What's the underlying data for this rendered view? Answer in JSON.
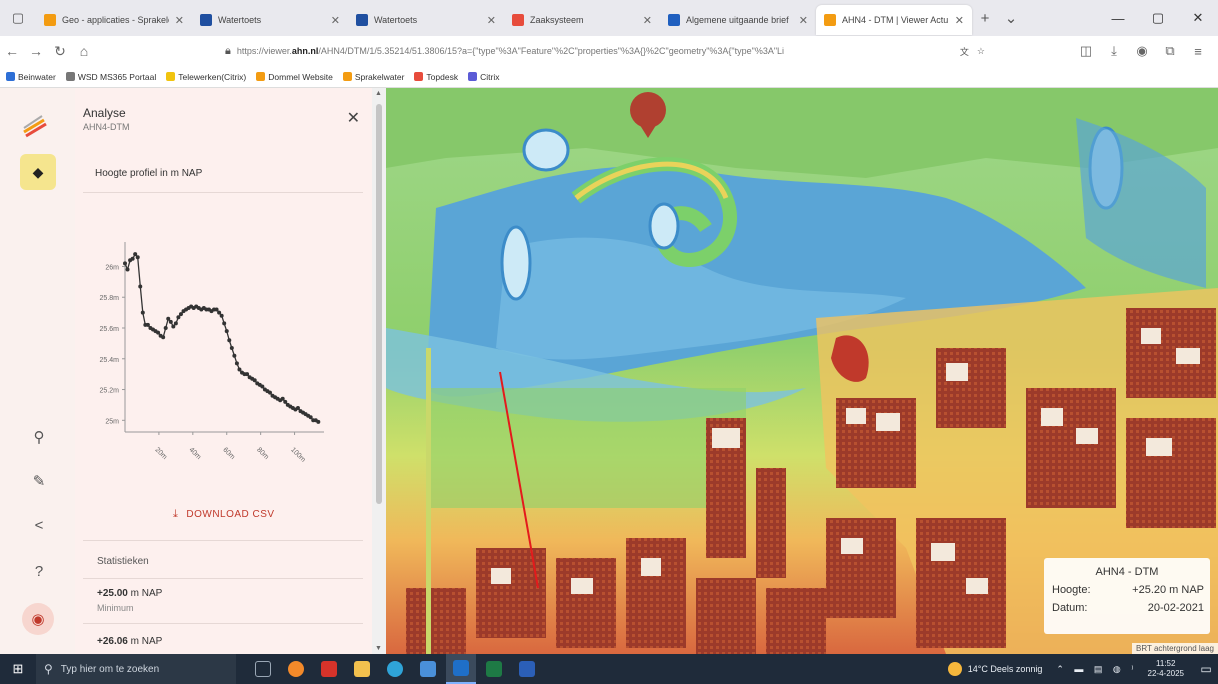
{
  "browser": {
    "tabs": [
      {
        "label": "Geo - applicaties - Sprakelen",
        "color": "#f39c12",
        "icon": "pen-icon",
        "active": false
      },
      {
        "label": "Watertoets",
        "color": "#1f4fa0",
        "icon": "g-icon",
        "active": false
      },
      {
        "label": "Watertoets",
        "color": "#1f4fa0",
        "icon": "g-icon",
        "active": false
      },
      {
        "label": "Zaaksysteem",
        "color": "#e74c3c",
        "icon": "o-icon",
        "active": false
      },
      {
        "label": "Algemene uitgaande brief",
        "color": "#1f5fbf",
        "icon": "outlook-icon",
        "active": false
      },
      {
        "label": "AHN4 - DTM | Viewer Actu",
        "color": "#f39c12",
        "icon": "pen-icon",
        "active": true
      }
    ],
    "url_prefix": "https://viewer.",
    "url_domain": "ahn.nl",
    "url_rest": "/AHN4/DTM/1/5.35214/51.3806/15?a={\"type\"%3A\"Feature\"%2C\"properties\"%3A{}%2C\"geometry\"%3A{\"type\"%3A\"Li",
    "bookmarks": [
      {
        "label": "Beinwater",
        "color": "#2e6fd6"
      },
      {
        "label": "WSD MS365 Portaal",
        "color": "#777"
      },
      {
        "label": "Telewerken(Citrix)",
        "color": "#f1c40f"
      },
      {
        "label": "Dommel Website",
        "color": "#f39c12"
      },
      {
        "label": "Sprakelwater",
        "color": "#f39c12"
      },
      {
        "label": "Topdesk",
        "color": "#e74c3c"
      },
      {
        "label": "Citrix",
        "color": "#5b5bd6"
      }
    ]
  },
  "panel": {
    "title": "Analyse",
    "subtitle": "AHN4-DTM",
    "section": "Hoogte profiel in m NAP",
    "download": "DOWNLOAD CSV",
    "stats_heading": "Statistieken",
    "stats": [
      {
        "value_num": "+25.00",
        "value_unit": "m NAP",
        "label": "Minimum"
      },
      {
        "value_num": "+26.06",
        "value_unit": "m NAP",
        "label": ""
      }
    ]
  },
  "chart_data": {
    "type": "line",
    "title": "",
    "xlabel": "",
    "ylabel": "",
    "y_tick_labels": [
      "25m",
      "25.2m",
      "25.4m",
      "25.6m",
      "25.8m",
      "26m"
    ],
    "x_tick_labels": [
      "20m",
      "40m",
      "60m",
      "80m",
      "100m"
    ],
    "ylim": [
      24.95,
      26.12
    ],
    "xlim": [
      0,
      115
    ],
    "series": [
      {
        "x": [
          0,
          1.5,
          3,
          4.5,
          6,
          7.5,
          9,
          10.5,
          12,
          13.5,
          15,
          16.5,
          18,
          19.5,
          21,
          22.5,
          24,
          25.5,
          27,
          28.5,
          30,
          31.5,
          33,
          34.5,
          36,
          37.5,
          39,
          40.5,
          42,
          43.5,
          45,
          46.5,
          48,
          49.5,
          51,
          52.5,
          54,
          55.5,
          57,
          58.5,
          60,
          61.5,
          63,
          64.5,
          66,
          67.5,
          69,
          70.5,
          72,
          73.5,
          75,
          76.5,
          78,
          79.5,
          81,
          82.5,
          84,
          85.5,
          87,
          88.5,
          90,
          91.5,
          93,
          94.5,
          96,
          97.5,
          99,
          100.5,
          102,
          103.5,
          105,
          106.5,
          108,
          109.5,
          111,
          112.5,
          114
        ],
        "y": [
          26.02,
          25.98,
          26.04,
          26.05,
          26.08,
          26.06,
          25.87,
          25.7,
          25.62,
          25.62,
          25.6,
          25.59,
          25.58,
          25.57,
          25.55,
          25.54,
          25.6,
          25.66,
          25.64,
          25.61,
          25.63,
          25.67,
          25.69,
          25.71,
          25.72,
          25.73,
          25.74,
          25.73,
          25.74,
          25.73,
          25.72,
          25.73,
          25.72,
          25.72,
          25.71,
          25.72,
          25.72,
          25.7,
          25.68,
          25.63,
          25.58,
          25.52,
          25.47,
          25.42,
          25.37,
          25.33,
          25.31,
          25.3,
          25.3,
          25.28,
          25.27,
          25.26,
          25.24,
          25.23,
          25.22,
          25.2,
          25.19,
          25.18,
          25.16,
          25.15,
          25.14,
          25.13,
          25.14,
          25.12,
          25.1,
          25.09,
          25.08,
          25.07,
          25.08,
          25.06,
          25.05,
          25.04,
          25.03,
          25.02,
          25.0,
          25.0,
          24.99
        ]
      }
    ]
  },
  "map": {
    "legend_title": "AHN4 - DTM",
    "height_label": "Hoogte:",
    "height_value": "+25.20 m NAP",
    "date_label": "Datum:",
    "date_value": "20-02-2021",
    "attribution": "BRT achtergrond laag"
  },
  "taskbar": {
    "search_placeholder": "Typ hier om te zoeken",
    "weather": "14°C Deels zonnig",
    "time": "11:52",
    "date": "22-4-2025"
  },
  "colors": {
    "accent": "#c0392b",
    "panel_bg": "#fdf0ee",
    "layer_btn": "#f5e58e"
  }
}
